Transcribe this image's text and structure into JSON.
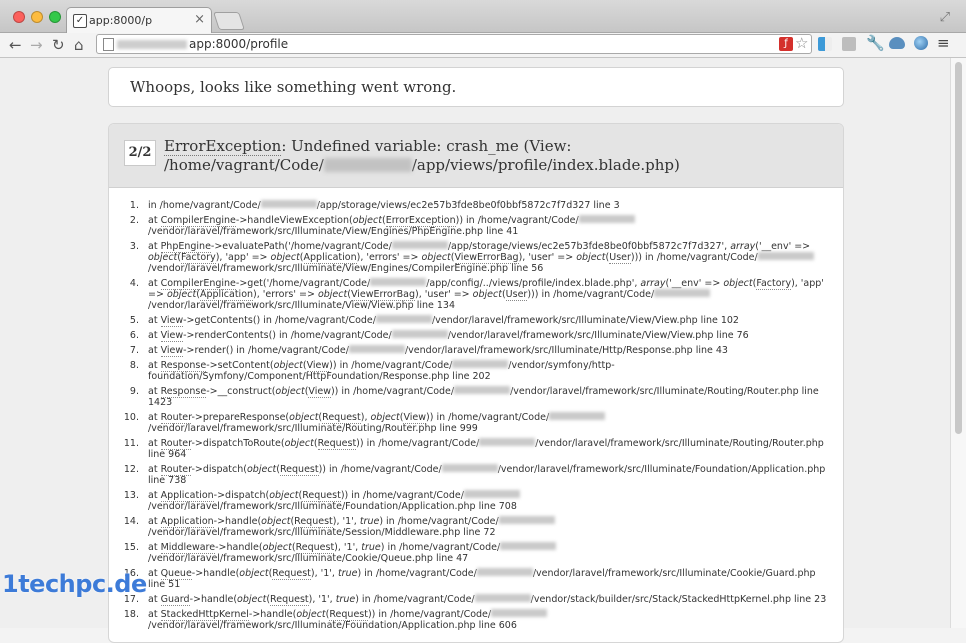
{
  "browser": {
    "tab": {
      "title": "app:8000/p"
    },
    "address": {
      "url": "app:8000/profile"
    }
  },
  "page": {
    "whoops": "Whoops, looks like something went wrong.",
    "exception": {
      "counter": "2/2",
      "class": "ErrorException",
      "message_line1": ": Undefined variable: crash_me (View:",
      "message_line2a": "/home/vagrant/Code/",
      "message_line2b": "/app/views/profile/index.blade.php)"
    },
    "frames": [
      {
        "num": "1.",
        "html": "in /home/vagrant/Code/<span class='rd'></span>/app/storage/views/ec2e57b3fde8be0f0bbf5872c7f7d327 line 3"
      },
      {
        "num": "2.",
        "html": "at <span class='cls'>CompilerEngine</span>->handleViewException(<i>object</i>(<span class='cls'>ErrorException</span>)) in /home/vagrant/Code/<span class='rd'></span>/vendor/laravel/framework/src/Illuminate/View/Engines/PhpEngine.php line 41"
      },
      {
        "num": "3.",
        "html": "at <span class='cls'>PhpEngine</span>->evaluatePath('/home/vagrant/Code/<span class='rd'></span>/app/storage/views/ec2e57b3fde8be0f0bbf5872c7f7d327', <i>array</i>('__env' => <i>object</i>(<span class='cls'>Factory</span>), 'app' => <i>object</i>(<span class='cls'>Application</span>), 'errors' => <i>object</i>(<span class='cls'>ViewErrorBag</span>), 'user' => <i>object</i>(<span class='cls'>User</span>))) in /home/vagrant/Code/<span class='rd'></span>/vendor/laravel/framework/src/Illuminate/View/Engines/CompilerEngine.php line 56"
      },
      {
        "num": "4.",
        "html": "at <span class='cls'>CompilerEngine</span>->get('/home/vagrant/Code/<span class='rd'></span>/app/config/../views/profile/index.blade.php', <i>array</i>('__env' => <i>object</i>(<span class='cls'>Factory</span>), 'app' => <i>object</i>(<span class='cls'>Application</span>), 'errors' => <i>object</i>(<span class='cls'>ViewErrorBag</span>), 'user' => <i>object</i>(<span class='cls'>User</span>))) in /home/vagrant/Code/<span class='rd'></span>/vendor/laravel/framework/src/Illuminate/View/View.php line 134"
      },
      {
        "num": "5.",
        "html": "at <span class='cls'>View</span>->getContents() in /home/vagrant/Code/<span class='rd'></span>/vendor/laravel/framework/src/Illuminate/View/View.php line 102"
      },
      {
        "num": "6.",
        "html": "at <span class='cls'>View</span>->renderContents() in /home/vagrant/Code/<span class='rd'></span>/vendor/laravel/framework/src/Illuminate/View/View.php line 76"
      },
      {
        "num": "7.",
        "html": "at <span class='cls'>View</span>->render() in /home/vagrant/Code/<span class='rd'></span>/vendor/laravel/framework/src/Illuminate/Http/Response.php line 43"
      },
      {
        "num": "8.",
        "html": "at <span class='cls'>Response</span>->setContent(<i>object</i>(<span class='cls'>View</span>)) in /home/vagrant/Code/<span class='rd'></span>/vendor/symfony/http-foundation/Symfony/Component/HttpFoundation/Response.php line 202"
      },
      {
        "num": "9.",
        "html": "at <span class='cls'>Response</span>->__construct(<i>object</i>(<span class='cls'>View</span>)) in /home/vagrant/Code/<span class='rd'></span>/vendor/laravel/framework/src/Illuminate/Routing/Router.php line 1423"
      },
      {
        "num": "10.",
        "html": "at <span class='cls'>Router</span>->prepareResponse(<i>object</i>(<span class='cls'>Request</span>), <i>object</i>(<span class='cls'>View</span>)) in /home/vagrant/Code/<span class='rd'></span>/vendor/laravel/framework/src/Illuminate/Routing/Router.php line 999"
      },
      {
        "num": "11.",
        "html": "at <span class='cls'>Router</span>->dispatchToRoute(<i>object</i>(<span class='cls'>Request</span>)) in /home/vagrant/Code/<span class='rd'></span>/vendor/laravel/framework/src/Illuminate/Routing/Router.php line 964"
      },
      {
        "num": "12.",
        "html": "at <span class='cls'>Router</span>->dispatch(<i>object</i>(<span class='cls'>Request</span>)) in /home/vagrant/Code/<span class='rd'></span>/vendor/laravel/framework/src/Illuminate/Foundation/Application.php line 738"
      },
      {
        "num": "13.",
        "html": "at <span class='cls'>Application</span>->dispatch(<i>object</i>(<span class='cls'>Request</span>)) in /home/vagrant/Code/<span class='rd'></span>/vendor/laravel/framework/src/Illuminate/Foundation/Application.php line 708"
      },
      {
        "num": "14.",
        "html": "at <span class='cls'>Application</span>->handle(<i>object</i>(<span class='cls'>Request</span>), '1', <i>true</i>) in /home/vagrant/Code/<span class='rd'></span>/vendor/laravel/framework/src/Illuminate/Session/Middleware.php line 72"
      },
      {
        "num": "15.",
        "html": "at <span class='cls'>Middleware</span>->handle(<i>object</i>(<span class='cls'>Request</span>), '1', <i>true</i>) in /home/vagrant/Code/<span class='rd'></span>/vendor/laravel/framework/src/Illuminate/Cookie/Queue.php line 47"
      },
      {
        "num": "16.",
        "html": "at <span class='cls'>Queue</span>->handle(<i>object</i>(<span class='cls'>Request</span>), '1', <i>true</i>) in /home/vagrant/Code/<span class='rd'></span>/vendor/laravel/framework/src/Illuminate/Cookie/Guard.php line 51"
      },
      {
        "num": "17.",
        "html": "at <span class='cls'>Guard</span>->handle(<i>object</i>(<span class='cls'>Request</span>), '1', <i>true</i>) in /home/vagrant/Code/<span class='rd'></span>/vendor/stack/builder/src/Stack/StackedHttpKernel.php line 23"
      },
      {
        "num": "18.",
        "html": "at <span class='cls'>StackedHttpKernel</span>->handle(<i>object</i>(<span class='cls'>Request</span>)) in /home/vagrant/Code/<span class='rd'></span>/vendor/laravel/framework/src/Illuminate/Foundation/Application.php line 606"
      }
    ]
  },
  "watermark": "1techpc.de"
}
